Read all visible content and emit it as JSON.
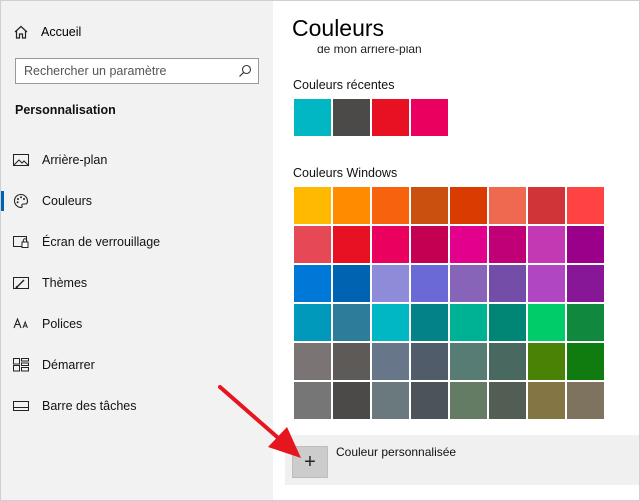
{
  "sidebar": {
    "home_label": "Accueil",
    "search_placeholder": "Rechercher un paramètre",
    "section_title": "Personnalisation",
    "items": [
      {
        "label": "Arrière-plan",
        "icon": "picture-icon"
      },
      {
        "label": "Couleurs",
        "icon": "palette-icon",
        "selected": true
      },
      {
        "label": "Écran de verrouillage",
        "icon": "lock-screen-icon"
      },
      {
        "label": "Thèmes",
        "icon": "themes-icon"
      },
      {
        "label": "Polices",
        "icon": "fonts-icon"
      },
      {
        "label": "Démarrer",
        "icon": "start-icon"
      },
      {
        "label": "Barre des tâches",
        "icon": "taskbar-icon"
      }
    ]
  },
  "main": {
    "title": "Couleurs",
    "cut_text": "de mon arrière-plan",
    "recent_label": "Couleurs récentes",
    "recent_colors": [
      "#00B7C3",
      "#4C4A48",
      "#E81123",
      "#EA005E"
    ],
    "windows_label": "Couleurs Windows",
    "windows_colors": [
      [
        "#FFB900",
        "#FF8C00",
        "#F7630C",
        "#CA5010",
        "#DA3B01",
        "#EF6950",
        "#D13438",
        "#FF4343"
      ],
      [
        "#E74856",
        "#E81123",
        "#EA005E",
        "#C30052",
        "#E3008C",
        "#BF0077",
        "#C239B3",
        "#9A0089"
      ],
      [
        "#0078D7",
        "#0063B1",
        "#8E8CD8",
        "#6B69D6",
        "#8764B8",
        "#744DA9",
        "#B146C2",
        "#881798"
      ],
      [
        "#0099BC",
        "#2D7D9A",
        "#00B7C3",
        "#038387",
        "#00B294",
        "#018574",
        "#00CC6A",
        "#10893E"
      ],
      [
        "#7A7574",
        "#5D5A58",
        "#68768A",
        "#515C6B",
        "#567C73",
        "#486860",
        "#498205",
        "#107C10"
      ],
      [
        "#767676",
        "#4C4A48",
        "#69797E",
        "#4A5459",
        "#647C64",
        "#525E54",
        "#847545",
        "#7E735F"
      ]
    ],
    "custom_label": "Couleur personnalisée",
    "plus_symbol": "+"
  }
}
